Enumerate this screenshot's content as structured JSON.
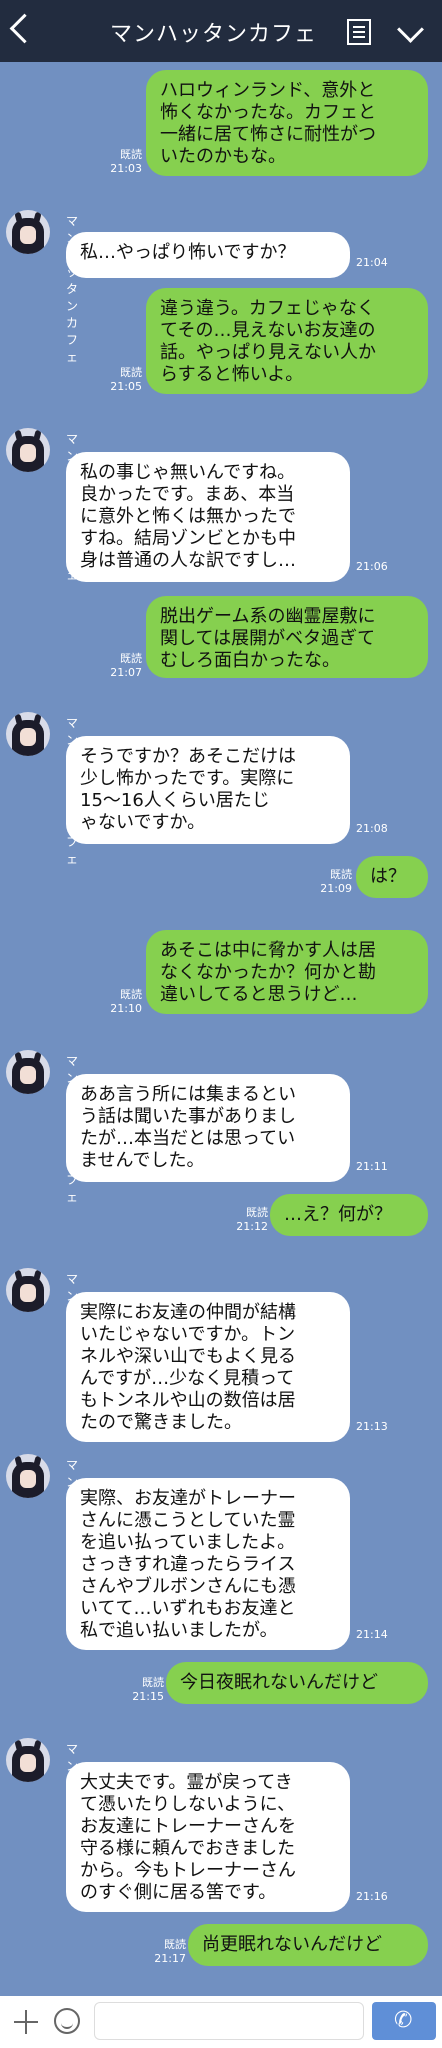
{
  "header": {
    "title": "マンハッタンカフェ"
  },
  "contact": {
    "name": "マンハッタンカフェ"
  },
  "meta": {
    "read": "既読"
  },
  "messages": [
    {
      "side": "sent",
      "text": "ハロウィンランド、意外と\n怖くなかったな。カフェと\n一緒に居て怖さに耐性がつ\nいたのかもな。",
      "time": "21:03",
      "read": true
    },
    {
      "side": "recv",
      "text": "私…やっぱり怖いですか？",
      "time": "21:04"
    },
    {
      "side": "sent",
      "text": "違う違う。カフェじゃなく\nてその…見えないお友達の\n話。やっぱり見えない人か\nらすると怖いよ。",
      "time": "21:05",
      "read": true
    },
    {
      "side": "recv",
      "text": "私の事じゃ無いんですね。\n良かったです。まあ、本当\nに意外と怖くは無かったで\nすね。結局ゾンビとかも中\n身は普通の人な訳ですし…",
      "time": "21:06"
    },
    {
      "side": "sent",
      "text": "脱出ゲーム系の幽霊屋敷に\n関しては展開がベタ過ぎて\nむしろ面白かったな。",
      "time": "21:07",
      "read": true
    },
    {
      "side": "recv",
      "text": "そうですか？あそこだけは\n少し怖かったです。実際に\n15〜16人くらい居たじ\nゃないですか。",
      "time": "21:08"
    },
    {
      "side": "sent",
      "text": "は？",
      "time": "21:09",
      "read": true
    },
    {
      "side": "sent",
      "text": "あそこは中に脅かす人は居\nなくなかったか？何かと勘\n違いしてると思うけど…",
      "time": "21:10",
      "read": true
    },
    {
      "side": "recv",
      "text": "ああ言う所には集まるとい\nう話は聞いた事がありまし\nたが…本当だとは思ってい\nませんでした。",
      "time": "21:11"
    },
    {
      "side": "sent",
      "text": "…え？何が？",
      "time": "21:12",
      "read": true
    },
    {
      "side": "recv",
      "text": "実際にお友達の仲間が結構\nいたじゃないですか。トン\nネルや深い山でもよく見る\nんですが…少なく見積って\nもトンネルや山の数倍は居\nたので驚きました。",
      "time": "21:13"
    },
    {
      "side": "recv",
      "text": "実際、お友達がトレーナー\nさんに憑こうとしていた霊\nを追い払っていましたよ。\nさっきすれ違ったらライス\nさんやブルボンさんにも憑\nいてて…いずれもお友達と\n私で追い払いましたが。",
      "time": "21:14"
    },
    {
      "side": "sent",
      "text": "今日夜眠れないんだけど",
      "time": "21:15",
      "read": true
    },
    {
      "side": "recv",
      "text": "大丈夫です。霊が戻ってき\nて憑いたりしないように、\nお友達にトレーナーさんを\n守る様に頼んでおきました\nから。今もトレーナーさん\nのすぐ側に居る筈です。",
      "time": "21:16"
    },
    {
      "side": "sent",
      "text": "尚更眠れないんだけど",
      "time": "21:17",
      "read": true
    }
  ]
}
